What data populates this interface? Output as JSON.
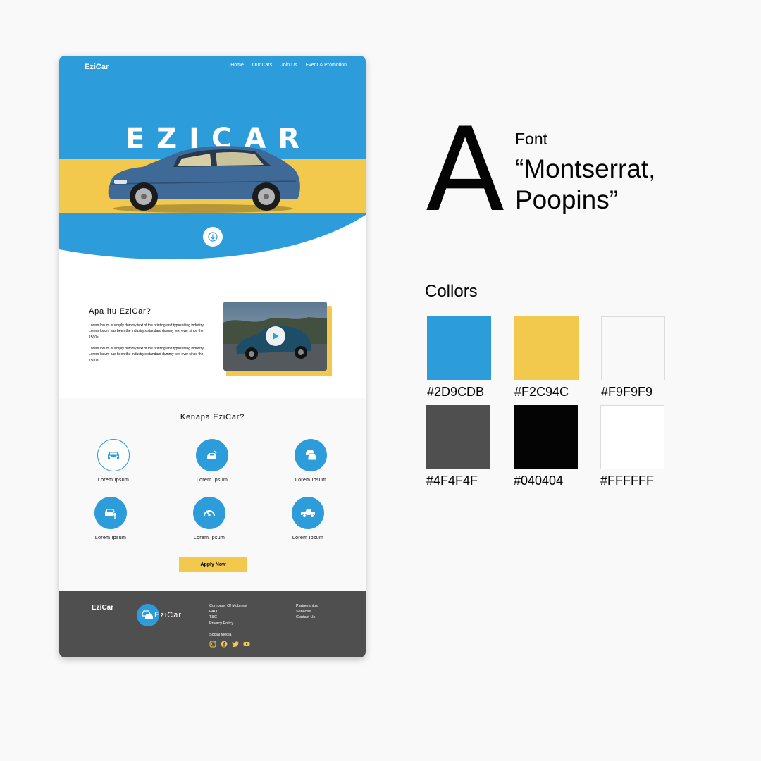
{
  "mockup": {
    "nav": {
      "logo": "EziCar",
      "links": [
        "Home",
        "Our Cars",
        "Join Us",
        "Event & Promotion"
      ]
    },
    "hero": {
      "title": "EZICAR"
    },
    "about": {
      "title": "Apa itu EziCar?",
      "paragraph1": "Lorem Ipsum is simply dummy text of the printing and typesetting industry. Lorem Ipsum has been the industry's standard dummy text ever since the 1500s",
      "paragraph2": "Lorem Ipsum is simply dummy text of the printing and typesetting industry. Lorem Ipsum has been the industry's standard dummy text ever since the 1500s"
    },
    "why": {
      "title": "Kenapa EziCar?",
      "features": [
        {
          "label": "Lorem Ipsum",
          "icon": "car-front-icon"
        },
        {
          "label": "Lorem Ipsum",
          "icon": "car-service-icon"
        },
        {
          "label": "Lorem Ipsum",
          "icon": "cars-fleet-icon"
        },
        {
          "label": "Lorem Ipsum",
          "icon": "car-key-icon"
        },
        {
          "label": "Lorem Ipsum",
          "icon": "speedometer-icon"
        },
        {
          "label": "Lorem Ipsum",
          "icon": "jeep-icon"
        }
      ],
      "apply_label": "Apply Now"
    },
    "footer": {
      "logo": "EziCar",
      "brand": "EziCar",
      "col1": [
        "Company Of Mobirent",
        "FAQ",
        "T&C",
        "Privacy Policy"
      ],
      "col2": [
        "Partnerships",
        "Services",
        "Contact Us"
      ],
      "social_title": "Social Media",
      "social_icons": [
        "instagram-icon",
        "facebook-icon",
        "twitter-icon",
        "youtube-icon"
      ]
    }
  },
  "style_guide": {
    "font_glyph": "A",
    "font_label": "Font",
    "font_names_line1": "“Montserrat,",
    "font_names_line2": "Poopins”",
    "colors_title": "Collors",
    "colors": [
      {
        "hex": "#2D9CDB",
        "value": "#2d9cdb"
      },
      {
        "hex": "#F2C94C",
        "value": "#f2c94c"
      },
      {
        "hex": "#F9F9F9",
        "value": "#f9f9f9"
      },
      {
        "hex": "#4F4F4F",
        "value": "#4f4f4f"
      },
      {
        "hex": "#040404",
        "value": "#040404"
      },
      {
        "hex": "#FFFFFF",
        "value": "#ffffff"
      }
    ]
  }
}
